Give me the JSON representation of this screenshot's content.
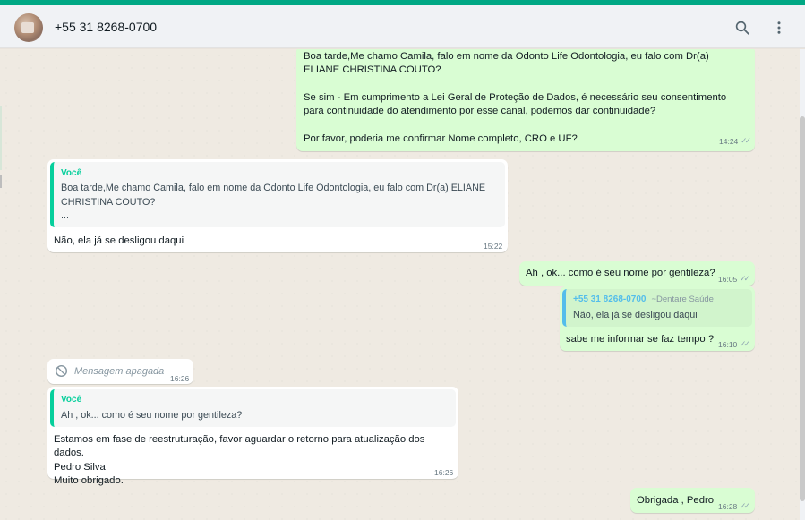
{
  "header": {
    "contact_name": "+55 31 8268-0700",
    "icons": [
      "search-icon",
      "menu-dots-icon"
    ]
  },
  "colors": {
    "accent": "#00a884",
    "outgoing_bubble": "#d9fdd3",
    "incoming_bubble": "#ffffff",
    "quote_bar_green": "#06cf9c",
    "quote_bar_blue": "#53bdeb"
  },
  "messages": [
    {
      "text": "Boa tarde,Me chamo Camila, falo em nome da Odonto Life Odontologia, eu falo com Dr(a) ELIANE CHRISTINA COUTO?\n\nSe sim - Em cumprimento a Lei Geral de Proteção de Dados, é necessário seu consentimento para continuidade do atendimento por esse canal, podemos dar continuidade?\n\nPor favor, poderia me confirmar Nome completo, CRO e UF?",
      "time": "14:24"
    },
    {
      "quote_author": "Você",
      "quote_text": "Boa tarde,Me chamo Camila, falo em nome da Odonto Life Odontologia, eu falo com Dr(a) ELIANE CHRISTINA COUTO?\n...",
      "text": "Não, ela já se desligou daqui",
      "time": "15:22"
    },
    {
      "text": "Ah , ok... como é seu nome por gentileza?",
      "time": "16:05"
    },
    {
      "quote_author": "+55 31 8268-0700",
      "quote_author_sub": "~Dentare Saúde",
      "quote_text": "Não, ela já se desligou daqui",
      "text": "sabe me informar se faz tempo ?",
      "time": "16:10"
    },
    {
      "text": "Mensagem apagada",
      "time": "16:26"
    },
    {
      "quote_author": "Você",
      "quote_text": "Ah , ok... como é seu nome por gentileza?",
      "text": "Estamos em fase de reestruturação, favor aguardar o retorno para atualização dos dados.\nPedro Silva\nMuito obrigado.",
      "time": "16:26"
    },
    {
      "text": "Obrigada , Pedro",
      "time": "16:28"
    }
  ]
}
